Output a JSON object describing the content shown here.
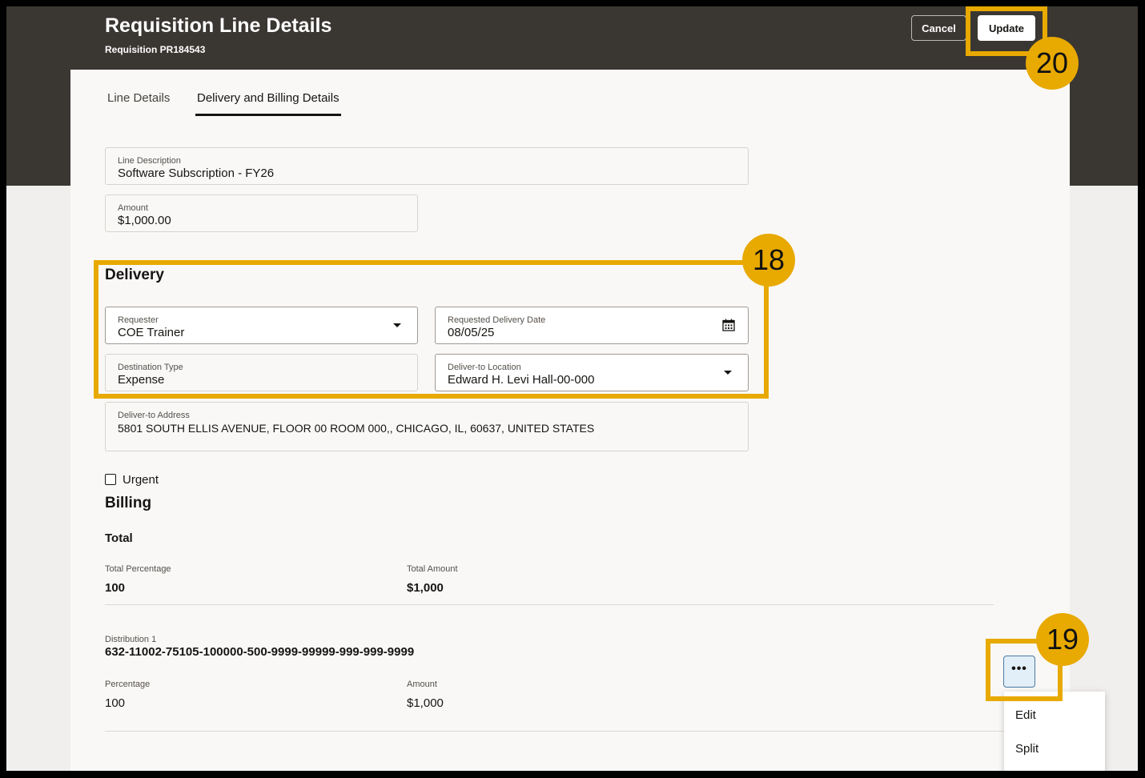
{
  "header": {
    "title": "Requisition Line Details",
    "subtitle": "Requisition PR184543",
    "cancel_label": "Cancel",
    "update_label": "Update"
  },
  "tabs": [
    {
      "label": "Line Details",
      "active": false
    },
    {
      "label": "Delivery and Billing Details",
      "active": true
    }
  ],
  "line": {
    "description_label": "Line Description",
    "description_value": "Software Subscription - FY26",
    "amount_label": "Amount",
    "amount_value": "$1,000.00"
  },
  "delivery": {
    "title": "Delivery",
    "requester_label": "Requester",
    "requester_value": "COE Trainer",
    "date_label": "Requested Delivery Date",
    "date_value": "08/05/25",
    "destination_label": "Destination Type",
    "destination_value": "Expense",
    "location_label": "Deliver-to Location",
    "location_value": "Edward H. Levi Hall-00-000",
    "address_label": "Deliver-to Address",
    "address_value": "5801 SOUTH ELLIS AVENUE, FLOOR 00 ROOM 000,, CHICAGO, IL, 60637, UNITED STATES",
    "urgent_label": "Urgent",
    "urgent_checked": false
  },
  "billing": {
    "title": "Billing",
    "total_title": "Total",
    "total_percentage_label": "Total Percentage",
    "total_percentage_value": "100",
    "total_amount_label": "Total Amount",
    "total_amount_value": "$1,000",
    "distribution_label": "Distribution 1",
    "distribution_value": "632-11002-75105-100000-500-9999-99999-999-999-9999",
    "percentage_label": "Percentage",
    "percentage_value": "100",
    "amount_label": "Amount",
    "amount_value": "$1,000",
    "more_label": "•••"
  },
  "menu": {
    "items": [
      "Edit",
      "Split"
    ]
  },
  "callouts": {
    "delivery": "18",
    "actions": "19",
    "update": "20"
  },
  "colors": {
    "header_bg": "#3a3632",
    "callout": "#e8a900",
    "page_bg": "#f1efed"
  }
}
